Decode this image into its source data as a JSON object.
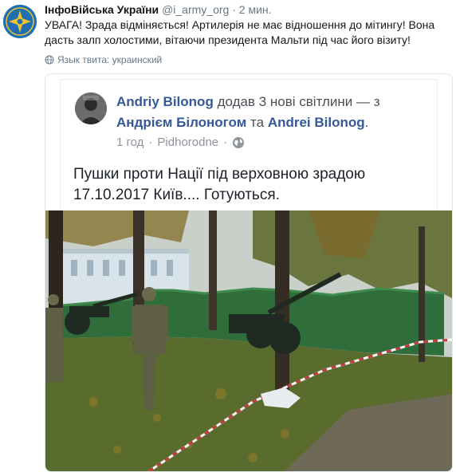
{
  "tweet": {
    "author_name": "ІнфоВійська України",
    "handle": "@i_army_org",
    "separator": "·",
    "time": "2 мин.",
    "text": "УВАГА! Зрада відміняється! Артилерія не має відношення до мітингу! Вона дасть залп холостими, вітаючи президента Мальти під час його візиту!",
    "language_note": "Язык твита: украинский"
  },
  "embedded_post": {
    "author": "Andriy Bilonog",
    "action": "додав 3 нові світлини — з",
    "tag1": "Андрієм Білоногом",
    "conj": "та",
    "tag2": "Andrei Bilonog",
    "period": ".",
    "time": "1 год",
    "dot": "·",
    "location": "Pidhorodne",
    "dot2": "·",
    "text": "Пушки проти Нації під верховною зрадою 17.10.2017 Київ.... Готуються."
  },
  "colors": {
    "accent": "#1f6fb2",
    "fb_link": "#365899",
    "muted": "#657786",
    "fence_green": "#2f6e3b",
    "grass": "#5a6b2e"
  },
  "icons": {
    "avatar": "ministry-emblem-icon",
    "language": "globe-icon",
    "privacy": "public-globe-icon"
  }
}
